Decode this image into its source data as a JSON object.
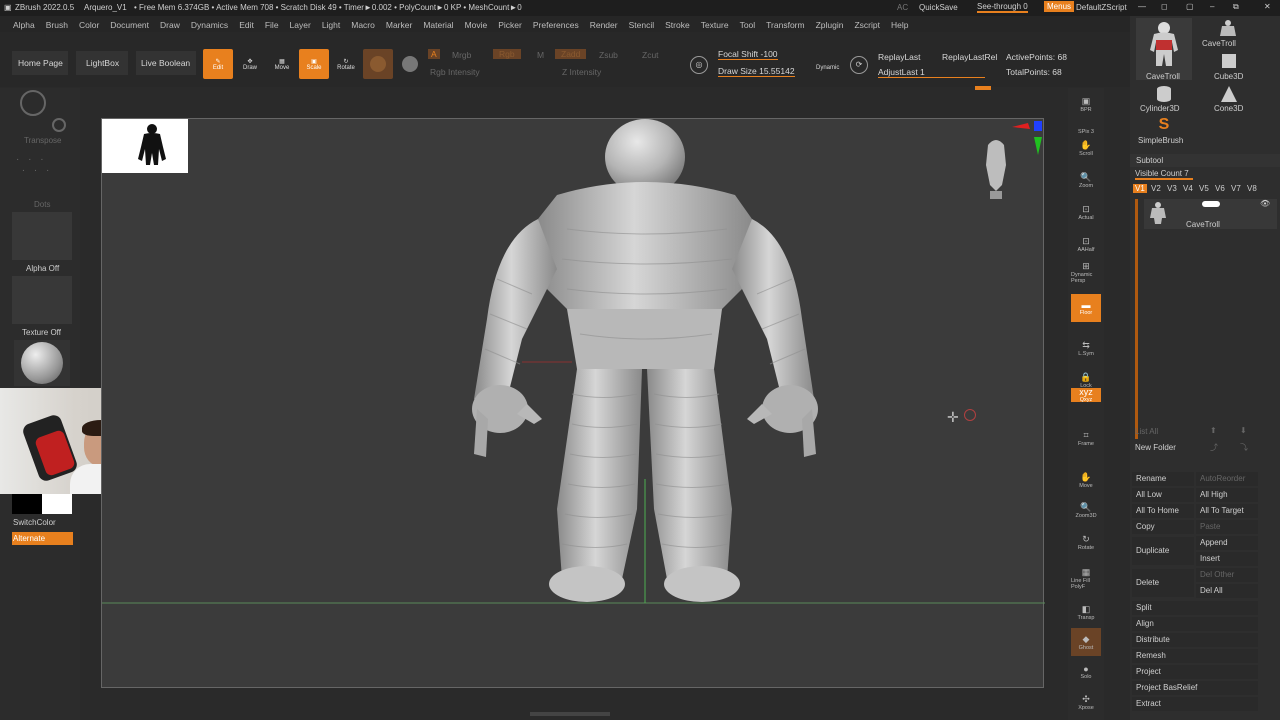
{
  "titlebar": {
    "app": "ZBrush 2022.0.5",
    "project": "Arquero_V1",
    "stats": "• Free Mem 6.374GB • Active Mem 708 • Scratch Disk 49 • Timer►0.002 • PolyCount►0 KP • MeshCount►0",
    "ac": "AC",
    "quicksave": "QuickSave",
    "seethrough": "See-through  0",
    "menus": "Menus",
    "script": "DefaultZScript"
  },
  "menubar": [
    "Alpha",
    "Brush",
    "Color",
    "Document",
    "Draw",
    "Dynamics",
    "Edit",
    "File",
    "Layer",
    "Light",
    "Macro",
    "Marker",
    "Material",
    "Movie",
    "Picker",
    "Preferences",
    "Render",
    "Stencil",
    "Stroke",
    "Texture",
    "Tool",
    "Transform",
    "Zplugin",
    "Zscript",
    "Help"
  ],
  "toolbar": {
    "home": "Home Page",
    "lightbox": "LightBox",
    "liveboolean": "Live Boolean",
    "edit": "Edit",
    "draw": "Draw",
    "move": "Move",
    "scale": "Scale",
    "rotate": "Rotate",
    "a": "A",
    "mrgb": "Mrgb",
    "rgb": "Rgb",
    "m": "M",
    "zadd": "Zadd",
    "zsub": "Zsub",
    "zcut": "Zcut",
    "rgbintensity": "Rgb Intensity",
    "zintensity": "Z Intensity",
    "focalshift": "Focal Shift -100",
    "drawsize": "Draw Size 15.55142",
    "dynamic": "Dynamic",
    "replaylast": "ReplayLast",
    "replaylastrel": "ReplayLastRel",
    "adjustlast": "AdjustLast 1",
    "activepoints": "ActivePoints: 68",
    "totalpoints": "TotalPoints: 68"
  },
  "leftshelf": {
    "transpose": "Transpose",
    "dots": "Dots",
    "alphaoff": "Alpha Off",
    "textureoff": "Texture Off",
    "switchcolor": "SwitchColor",
    "alternate": "Alternate"
  },
  "rightshelf": [
    "BPR",
    "SPix 3",
    "Scroll",
    "Zoom",
    "Actual",
    "AAHalf",
    "Dynamic Persp",
    "Floor",
    "L.Sym",
    "Lock",
    "Qxyz",
    "Frame",
    "Move",
    "Zoom3D",
    "Rotate",
    "Line Fill PolyF",
    "Transp",
    "Ghost",
    "Solo",
    "Xpose"
  ],
  "tools": [
    {
      "name": "CaveTroll"
    },
    {
      "name": "CaveTroll"
    },
    {
      "name": "Cube3D"
    },
    {
      "name": "Cylinder3D"
    },
    {
      "name": "Cone3D"
    },
    {
      "name": "SimpleBrush"
    }
  ],
  "subtool": {
    "header": "Subtool",
    "visiblecount": "Visible Count 7",
    "versions": [
      "V1",
      "V2",
      "V3",
      "V4",
      "V5",
      "V6",
      "V7",
      "V8"
    ],
    "item": "CaveTroll",
    "listall": "List All",
    "newfolder": "New Folder",
    "rename": "Rename",
    "autoreorder": "AutoReorder",
    "alllow": "All Low",
    "allhigh": "All High",
    "alltohome": "All To Home",
    "alltotarget": "All To Target",
    "copy": "Copy",
    "paste": "Paste",
    "duplicate": "Duplicate",
    "append": "Append",
    "insert": "Insert",
    "delete": "Delete",
    "delother": "Del Other",
    "delall": "Del All",
    "split": "Split",
    "align": "Align",
    "distribute": "Distribute",
    "remesh": "Remesh",
    "project": "Project",
    "projectbasrelief": "Project BasRelief",
    "extract": "Extract"
  },
  "colors": {
    "accent": "#e8801e",
    "background": "#3b3b3b",
    "panel": "#2e2e2e"
  }
}
